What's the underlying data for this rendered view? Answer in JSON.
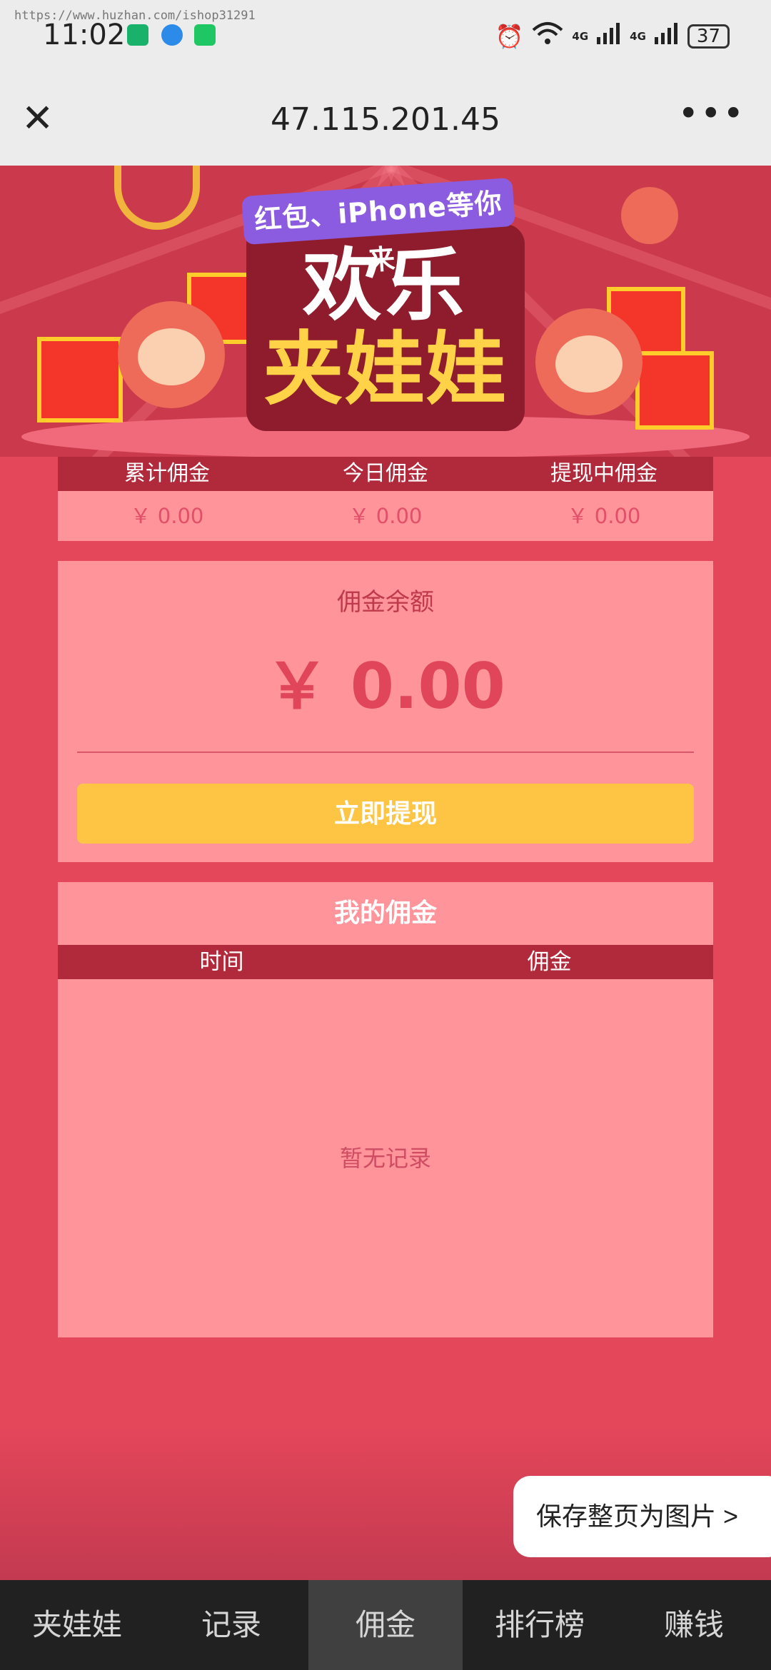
{
  "watermark": "https://www.huzhan.com/ishop31291",
  "status_bar": {
    "time": "11:02",
    "network_1": "4G",
    "network_2": "4G",
    "battery": "37"
  },
  "browser_bar": {
    "close_icon": "close-icon",
    "title": "47.115.201.45",
    "more_icon": "more-icon"
  },
  "banner": {
    "subtitle": "红包、iPhone等你来",
    "title_line1": "欢乐",
    "title_line2": "夹娃娃"
  },
  "stats": {
    "headers": [
      "累计佣金",
      "今日佣金",
      "提现中佣金"
    ],
    "values": [
      "￥ 0.00",
      "￥ 0.00",
      "￥ 0.00"
    ]
  },
  "balance": {
    "label": "佣金余额",
    "amount": "￥ 0.00",
    "withdraw_button": "立即提现"
  },
  "records": {
    "title": "我的佣金",
    "columns": [
      "时间",
      "佣金"
    ],
    "empty_text": "暂无记录"
  },
  "save_page_button": "保存整页为图片 >",
  "nav": {
    "items": [
      "夹娃娃",
      "记录",
      "佣金",
      "排行榜",
      "赚钱"
    ],
    "active": "佣金"
  },
  "colors": {
    "page_bg": "#e4465a",
    "panel_bg": "#ff949b",
    "header_bar": "#b12a3c",
    "button_yellow": "#fec443",
    "nav_bg": "#212121"
  }
}
